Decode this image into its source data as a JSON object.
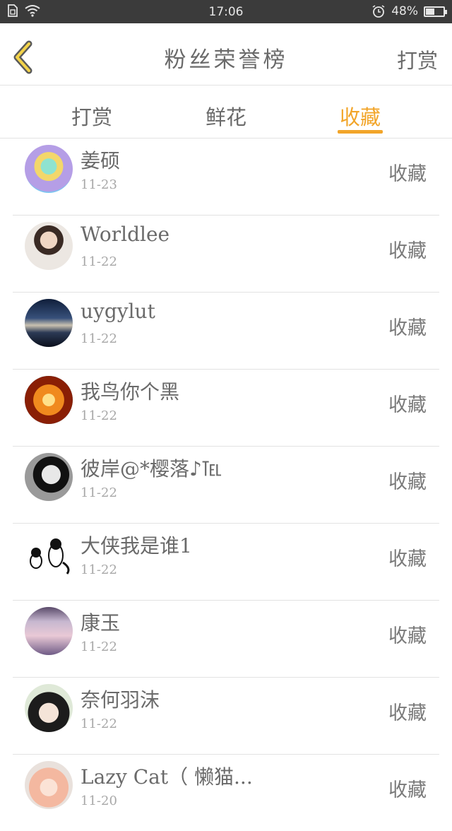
{
  "status_bar": {
    "time": "17:06",
    "battery": "48%",
    "battery_level": 0.48,
    "icons": [
      "sim-icon",
      "wifi-icon",
      "alarm-icon",
      "battery-icon"
    ]
  },
  "header": {
    "title": "粉丝荣誉榜",
    "right_link": "打赏",
    "back_icon": "chevron-left-icon",
    "accent_color": "#f2a52a"
  },
  "tabs": [
    {
      "label": "打赏",
      "active": false
    },
    {
      "label": "鲜花",
      "active": false
    },
    {
      "label": "收藏",
      "active": true
    }
  ],
  "fans": [
    {
      "name": "姜硕",
      "date": "11-23",
      "action": "收藏"
    },
    {
      "name": "Worldlee",
      "date": "11-22",
      "action": "收藏"
    },
    {
      "name": "uygylut",
      "date": "11-22",
      "action": "收藏"
    },
    {
      "name": "我鸟你个黑",
      "date": "11-22",
      "action": "收藏"
    },
    {
      "name": "彼岸@*樱落♪℡",
      "date": "11-22",
      "action": "收藏"
    },
    {
      "name": "大侠我是谁1",
      "date": "11-22",
      "action": "收藏"
    },
    {
      "name": "康玉",
      "date": "11-22",
      "action": "收藏"
    },
    {
      "name": "奈何羽沫",
      "date": "11-22",
      "action": "收藏"
    },
    {
      "name": "Lazy Cat（ 懒猫...",
      "date": "11-20",
      "action": "收藏"
    }
  ]
}
